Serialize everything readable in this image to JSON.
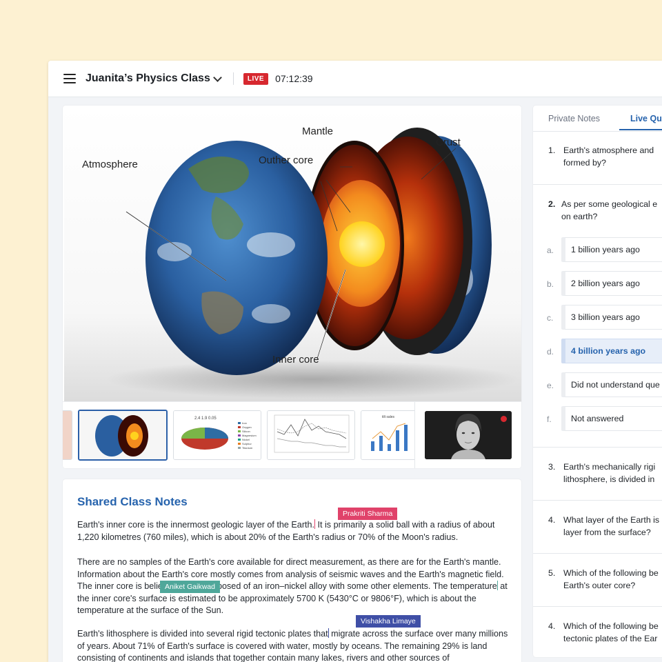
{
  "header": {
    "class_title": "Juanita’s Physics Class",
    "live_label": "LIVE",
    "timer": "07:12:39"
  },
  "slide": {
    "labels": {
      "atmosphere": "Atmosphere",
      "mantle": "Mantle",
      "outer_core": "Outher core",
      "crust": "Crust",
      "inner_core": "Inner core"
    }
  },
  "notes": {
    "title": "Shared Class Notes",
    "p1a": "Earth's inner core is the innermost geologic layer of the Earth.",
    "p1b": " It is primarily a solid ball with a radius of about 1,220 kilometres (760 miles), which is about 20% of the Earth's radius or 70% of the Moon's radius.",
    "p2a": "There are no samples of the Earth's core available for direct measurement, as there are for the Earth's mantle. Information about the Earth's core mostly comes from analysis of seismic waves and the Earth's magnetic field. The inner core is believed to be composed of an iron–nickel alloy with some other elements. The temperature",
    "p2b": " at the inner core's surface is estimated to be approximately 5700 K (5430°C or 9806°F), which is about the temperature at the surface of the Sun.",
    "p3a": "Earth's lithosphere is divided into several rigid tectonic plates that",
    "p3b": " migrate across the surface over many millions of years. About 71% of Earth's surface is covered with water, mostly by oceans. The remaining 29% is land consisting of continents and islands that together contain many lakes, rivers and other sources of",
    "cursors": [
      {
        "name": "Prakriti Sharma",
        "color": "#E0426A"
      },
      {
        "name": "Aniket Gaikwad",
        "color": "#4FA79A"
      },
      {
        "name": "Vishakha Limaye",
        "color": "#3F4FA6"
      }
    ]
  },
  "sidebar": {
    "tabs": [
      "Private Notes",
      "Live Qu"
    ],
    "questions": [
      {
        "num": "1.",
        "line1": "Earth's atmosphere and",
        "line2": "formed by?"
      },
      {
        "num": "2.",
        "line1": "As per some geological e",
        "line2": "on earth?"
      },
      {
        "num": "3.",
        "line1": "Earth's mechanically rigi",
        "line2": "lithosphere, is divided in"
      },
      {
        "num": "4.",
        "line1": "What layer of the Earth is",
        "line2": "layer from the surface?"
      },
      {
        "num": "5.",
        "line1": "Which of the following be",
        "line2": "Earth's outer core?"
      },
      {
        "num": "4.",
        "line1": "Which of the following be",
        "line2": "tectonic plates of the Ear"
      }
    ],
    "options": [
      {
        "letter": "a.",
        "text": "1 billion years ago",
        "selected": false
      },
      {
        "letter": "b.",
        "text": "2 billion years ago",
        "selected": false
      },
      {
        "letter": "c.",
        "text": "3 billion years ago",
        "selected": false
      },
      {
        "letter": "d.",
        "text": "4 billion years ago",
        "selected": true
      },
      {
        "letter": "e.",
        "text": "Did not understand que",
        "selected": false
      },
      {
        "letter": "f.",
        "text": "Not answered",
        "selected": false
      }
    ]
  },
  "thumbnails": {
    "pie_label": "2.4  1.9  0.05",
    "legend": [
      "Iron",
      "Oxygen",
      "Silicon",
      "Magnesium",
      "Nickel",
      "Sulphur",
      "Titanium"
    ],
    "bar_title": "tilt sales"
  }
}
